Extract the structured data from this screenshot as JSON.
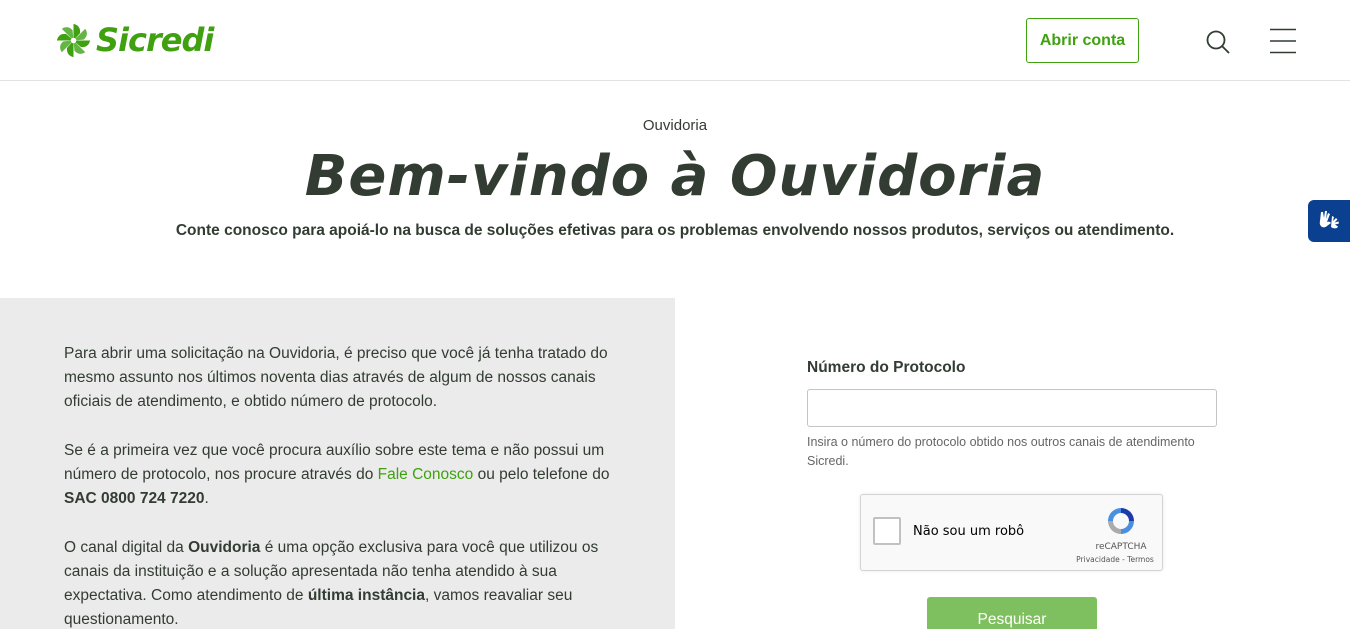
{
  "header": {
    "logo_text": "Sicredi",
    "open_account_label": "Abrir conta",
    "icons": {
      "search": "search-icon",
      "menu": "hamburger-menu-icon"
    }
  },
  "hero": {
    "eyebrow": "Ouvidoria",
    "title": "Bem-vindo à Ouvidoria",
    "subtitle": "Conte conosco para apoiá-lo na busca de soluções efetivas para os problemas envolvendo nossos produtos, serviços ou atendimento."
  },
  "accessibility": {
    "icon": "sign-language-hands-icon"
  },
  "info": {
    "p1": "Para abrir uma solicitação na Ouvidoria, é preciso que você já tenha tratado do mesmo assunto nos últimos noventa dias através de algum de nossos canais oficiais de atendimento, e obtido número de protocolo.",
    "p2_a": "Se é a primeira vez que você procura auxílio sobre este tema e não possui um número de protocolo, nos procure através do ",
    "p2_link": "Fale Conosco",
    "p2_b": " ou pelo telefone do ",
    "p2_bold": "SAC 0800 724 7220",
    "p2_c": ".",
    "p3_a": "O canal digital da ",
    "p3_bold1": "Ouvidoria",
    "p3_b": " é uma opção exclusiva para você que utilizou os canais da instituição e a solução apresentada não tenha atendido à sua expectativa. Como atendimento de ",
    "p3_bold2": "última instância",
    "p3_c": ", vamos reavaliar seu questionamento."
  },
  "form": {
    "protocol_label": "Número do Protocolo",
    "protocol_value": "",
    "protocol_hint": "Insira o número do protocolo obtido nos outros canais de atendimento Sicredi.",
    "captcha_label": "Não sou um robô",
    "captcha_brand": "reCAPTCHA",
    "captcha_links": "Privacidade - Termos",
    "submit_label": "Pesquisar"
  },
  "colors": {
    "brand_green": "#3fa110",
    "button_green_light": "#7ebf5f",
    "text_dark": "#323c32",
    "panel_gray": "#ebebeb",
    "a11y_blue": "#0b3f8f"
  }
}
